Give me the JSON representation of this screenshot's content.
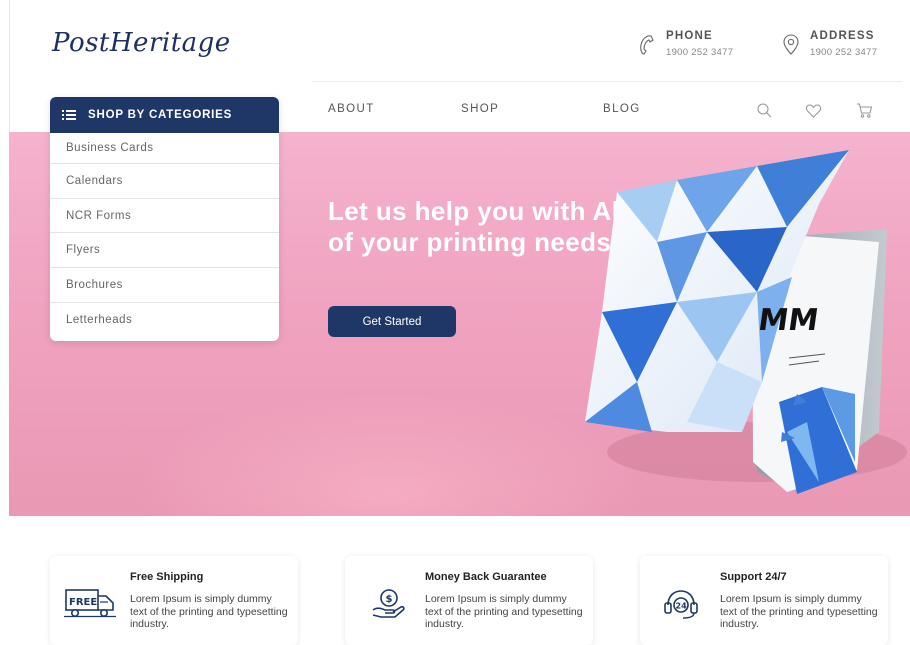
{
  "brand": {
    "logo_text": "PostHeritage"
  },
  "contact": {
    "phone": {
      "label": "PHONE",
      "value": "1900 252 3477",
      "icon": "phone-icon"
    },
    "address": {
      "label": "ADDRESS",
      "value": "1900 252 3477",
      "icon": "location-pin-icon"
    }
  },
  "nav": {
    "items": [
      {
        "label": "ABOUT"
      },
      {
        "label": "SHOP"
      },
      {
        "label": "BLOG"
      }
    ],
    "icons": [
      "search-icon",
      "heart-icon",
      "cart-icon"
    ]
  },
  "categories": {
    "header": "SHOP BY CATEGORIES",
    "items": [
      {
        "label": "Business Cards"
      },
      {
        "label": "Calendars"
      },
      {
        "label": "NCR Forms"
      },
      {
        "label": "Flyers"
      },
      {
        "label": "Brochures"
      },
      {
        "label": "Letterheads"
      }
    ]
  },
  "hero": {
    "title": "Let us help you with All of your printing needs",
    "cta_label": "Get Started",
    "brochure_letters": "MM"
  },
  "features": [
    {
      "title": "Free Shipping",
      "desc": "Lorem Ipsum is simply dummy text of the printing and typesetting industry.",
      "icon": "free-shipping-truck-icon",
      "icon_text": "FREE"
    },
    {
      "title": "Money Back Guarantee",
      "desc": "Lorem Ipsum is simply dummy text of the printing and typesetting industry.",
      "icon": "money-back-hand-icon"
    },
    {
      "title": "Support 24/7",
      "desc": "Lorem Ipsum is simply dummy text of the printing and typesetting industry.",
      "icon": "support-headset-icon",
      "icon_text": "24"
    }
  ],
  "colors": {
    "navy": "#1f3767",
    "hero_pink": "#f0a3c0",
    "brochure_blue": "#3f7fd8"
  }
}
